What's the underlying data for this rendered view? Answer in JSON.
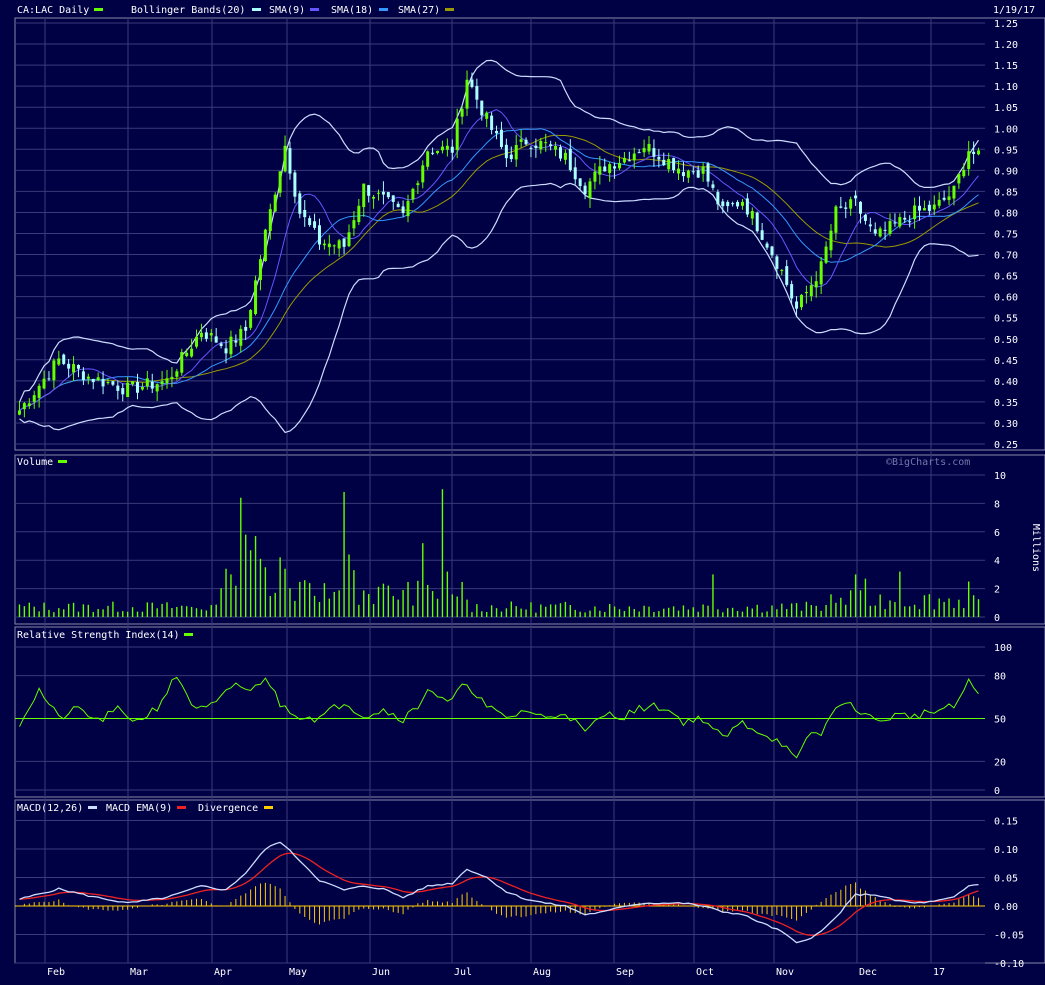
{
  "colors": {
    "background": "#000044",
    "grid": "#3a3a7a",
    "border": "#8888aa",
    "text": "#ffffff",
    "price_green": "#66ff00",
    "price_cyan": "#aaffff",
    "bollinger": "#ccddff",
    "sma9": "#6655ff",
    "sma18": "#3399ff",
    "sma27": "#999900",
    "volume": "#66ff00",
    "rsi": "#66ff00",
    "macd": "#ccddff",
    "macd_ema": "#ee2222",
    "divergence": "#ffcc00",
    "watermark": "#7777aa"
  },
  "header": {
    "symbol": "CA:LAC Daily",
    "bollinger": "Bollinger Bands(20)",
    "sma9": "SMA(9)",
    "sma18": "SMA(18)",
    "sma27": "SMA(27)",
    "date": "1/19/17"
  },
  "watermark": "©BigCharts.com",
  "chart_data": [
    {
      "type": "candlestick",
      "title": "CA:LAC Daily",
      "x_labels": [
        "Feb",
        "Mar",
        "Apr",
        "May",
        "Jun",
        "Jul",
        "Aug",
        "Sep",
        "Oct",
        "Nov",
        "Dec",
        "17"
      ],
      "y_ticks": [
        "1.25",
        "1.20",
        "1.15",
        "1.10",
        "1.05",
        "1.00",
        "0.95",
        "0.90",
        "0.85",
        "0.80",
        "0.75",
        "0.70",
        "0.65",
        "0.60",
        "0.55",
        "0.50",
        "0.45",
        "0.40",
        "0.35",
        "0.30",
        "0.25"
      ],
      "ylim": [
        0.25,
        1.25
      ],
      "close_keypoints": [
        [
          0,
          0.33
        ],
        [
          8,
          0.45
        ],
        [
          14,
          0.41
        ],
        [
          22,
          0.38
        ],
        [
          30,
          0.4
        ],
        [
          37,
          0.52
        ],
        [
          42,
          0.48
        ],
        [
          46,
          0.52
        ],
        [
          50,
          0.75
        ],
        [
          54,
          0.96
        ],
        [
          57,
          0.8
        ],
        [
          61,
          0.73
        ],
        [
          66,
          0.72
        ],
        [
          70,
          0.86
        ],
        [
          74,
          0.83
        ],
        [
          78,
          0.79
        ],
        [
          83,
          0.95
        ],
        [
          88,
          0.95
        ],
        [
          91,
          1.12
        ],
        [
          95,
          1.02
        ],
        [
          99,
          0.93
        ],
        [
          103,
          0.97
        ],
        [
          107,
          0.96
        ],
        [
          111,
          0.93
        ],
        [
          115,
          0.86
        ],
        [
          119,
          0.91
        ],
        [
          123,
          0.93
        ],
        [
          127,
          0.96
        ],
        [
          131,
          0.93
        ],
        [
          135,
          0.9
        ],
        [
          139,
          0.9
        ],
        [
          143,
          0.8
        ],
        [
          147,
          0.83
        ],
        [
          151,
          0.75
        ],
        [
          155,
          0.66
        ],
        [
          158,
          0.57
        ],
        [
          161,
          0.63
        ],
        [
          163,
          0.67
        ],
        [
          166,
          0.8
        ],
        [
          170,
          0.82
        ],
        [
          174,
          0.74
        ],
        [
          178,
          0.77
        ],
        [
          182,
          0.8
        ],
        [
          186,
          0.81
        ],
        [
          190,
          0.85
        ],
        [
          193,
          0.95
        ],
        [
          195,
          0.93
        ]
      ],
      "series": [
        {
          "name": "CA:LAC Daily"
        },
        {
          "name": "Bollinger Bands(20)"
        },
        {
          "name": "SMA(9)"
        },
        {
          "name": "SMA(18)"
        },
        {
          "name": "SMA(27)"
        }
      ]
    },
    {
      "type": "bar",
      "title": "Volume",
      "ylabel": "Millions",
      "y_ticks": [
        "10",
        "8",
        "6",
        "4",
        "2",
        "0"
      ],
      "ylim": [
        0,
        10
      ],
      "spikes": [
        [
          42,
          3.4
        ],
        [
          43,
          3.0
        ],
        [
          45,
          8.4
        ],
        [
          46,
          5.8
        ],
        [
          47,
          4.7
        ],
        [
          48,
          5.7
        ],
        [
          49,
          4.1
        ],
        [
          50,
          3.5
        ],
        [
          53,
          4.2
        ],
        [
          54,
          3.4
        ],
        [
          66,
          8.8
        ],
        [
          67,
          4.4
        ],
        [
          68,
          3.3
        ],
        [
          82,
          5.2
        ],
        [
          86,
          9.0
        ],
        [
          87,
          3.2
        ],
        [
          141,
          3.0
        ],
        [
          170,
          3.0
        ],
        [
          172,
          2.7
        ],
        [
          179,
          3.2
        ],
        [
          193,
          2.5
        ]
      ],
      "series": [
        {
          "name": "Volume"
        }
      ]
    },
    {
      "type": "line",
      "title": "Relative Strength Index(14)",
      "y_ticks": [
        "100",
        "80",
        "50",
        "20",
        "0"
      ],
      "ylim": [
        0,
        100
      ],
      "reference_line": 50,
      "keypoints": [
        [
          0,
          47
        ],
        [
          4,
          70
        ],
        [
          8,
          50
        ],
        [
          12,
          57
        ],
        [
          16,
          48
        ],
        [
          20,
          56
        ],
        [
          24,
          48
        ],
        [
          28,
          58
        ],
        [
          32,
          80
        ],
        [
          36,
          55
        ],
        [
          40,
          60
        ],
        [
          44,
          75
        ],
        [
          47,
          68
        ],
        [
          50,
          80
        ],
        [
          53,
          60
        ],
        [
          57,
          52
        ],
        [
          61,
          50
        ],
        [
          66,
          62
        ],
        [
          70,
          52
        ],
        [
          74,
          56
        ],
        [
          78,
          50
        ],
        [
          81,
          58
        ],
        [
          83,
          72
        ],
        [
          87,
          60
        ],
        [
          91,
          75
        ],
        [
          95,
          58
        ],
        [
          99,
          50
        ],
        [
          103,
          56
        ],
        [
          107,
          50
        ],
        [
          111,
          55
        ],
        [
          115,
          40
        ],
        [
          119,
          53
        ],
        [
          123,
          52
        ],
        [
          127,
          58
        ],
        [
          131,
          58
        ],
        [
          135,
          48
        ],
        [
          139,
          50
        ],
        [
          143,
          36
        ],
        [
          147,
          47
        ],
        [
          151,
          40
        ],
        [
          155,
          33
        ],
        [
          158,
          20
        ],
        [
          161,
          41
        ],
        [
          163,
          38
        ],
        [
          166,
          60
        ],
        [
          170,
          58
        ],
        [
          174,
          48
        ],
        [
          178,
          52
        ],
        [
          182,
          52
        ],
        [
          186,
          55
        ],
        [
          190,
          58
        ],
        [
          193,
          75
        ],
        [
          195,
          68
        ]
      ],
      "series": [
        {
          "name": "Relative Strength Index(14)"
        }
      ]
    },
    {
      "type": "line",
      "title": "MACD(12,26)",
      "y_ticks": [
        "0.15",
        "0.10",
        "0.05",
        "0.00",
        "-0.05",
        "-0.10"
      ],
      "ylim": [
        -0.1,
        0.15
      ],
      "macd_keypoints": [
        [
          0,
          0.012
        ],
        [
          8,
          0.03
        ],
        [
          14,
          0.018
        ],
        [
          22,
          0.005
        ],
        [
          30,
          0.015
        ],
        [
          37,
          0.035
        ],
        [
          42,
          0.028
        ],
        [
          46,
          0.058
        ],
        [
          50,
          0.1
        ],
        [
          53,
          0.113
        ],
        [
          57,
          0.08
        ],
        [
          61,
          0.045
        ],
        [
          66,
          0.028
        ],
        [
          70,
          0.035
        ],
        [
          74,
          0.03
        ],
        [
          78,
          0.015
        ],
        [
          83,
          0.035
        ],
        [
          88,
          0.04
        ],
        [
          91,
          0.065
        ],
        [
          95,
          0.05
        ],
        [
          99,
          0.025
        ],
        [
          103,
          0.012
        ],
        [
          107,
          0.005
        ],
        [
          111,
          0.0
        ],
        [
          115,
          -0.015
        ],
        [
          119,
          -0.01
        ],
        [
          123,
          0.0
        ],
        [
          127,
          0.005
        ],
        [
          131,
          0.005
        ],
        [
          135,
          0.005
        ],
        [
          139,
          0.0
        ],
        [
          143,
          -0.01
        ],
        [
          147,
          -0.015
        ],
        [
          151,
          -0.03
        ],
        [
          155,
          -0.045
        ],
        [
          158,
          -0.065
        ],
        [
          161,
          -0.055
        ],
        [
          163,
          -0.045
        ],
        [
          166,
          -0.02
        ],
        [
          170,
          0.02
        ],
        [
          174,
          0.02
        ],
        [
          178,
          0.01
        ],
        [
          182,
          0.005
        ],
        [
          186,
          0.008
        ],
        [
          190,
          0.015
        ],
        [
          193,
          0.035
        ],
        [
          195,
          0.038
        ]
      ],
      "series": [
        {
          "name": "MACD(12,26)"
        },
        {
          "name": "MACD EMA(9)"
        },
        {
          "name": "Divergence"
        }
      ]
    }
  ]
}
